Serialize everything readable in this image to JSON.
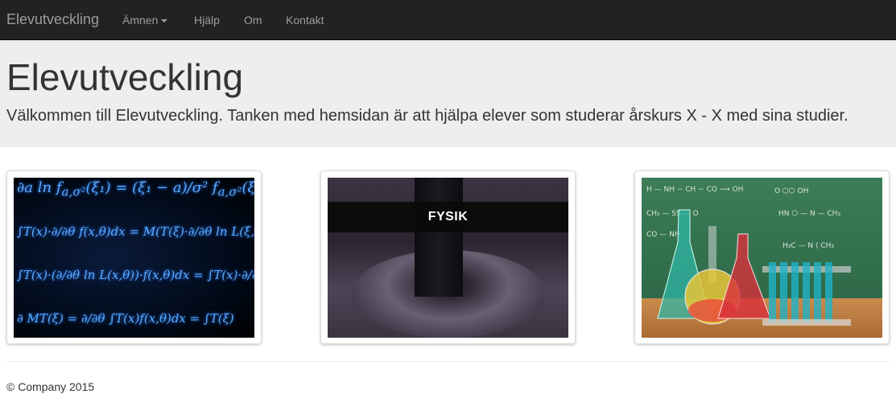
{
  "navbar": {
    "brand": "Elevutveckling",
    "items": [
      {
        "label": "Ämnen",
        "has_dropdown": true
      },
      {
        "label": "Hjälp"
      },
      {
        "label": "Om"
      },
      {
        "label": "Kontakt"
      }
    ]
  },
  "jumbotron": {
    "title": "Elevutveckling",
    "text": "Välkommen till Elevutveckling. Tanken med hemsidan är att hjälpa elever som studerar årskurs X - X med sina studier."
  },
  "thumbnails": [
    {
      "subject": "math",
      "icon": "math-formulas-image"
    },
    {
      "subject": "physics",
      "icon": "physics-magnet-image",
      "banner": "FYSIK"
    },
    {
      "subject": "chemistry",
      "icon": "chemistry-flasks-image"
    }
  ],
  "footer": {
    "text": "© Company 2015"
  },
  "colors": {
    "navbar_bg": "#222222",
    "nav_text": "#9d9d9d",
    "jumbotron_bg": "#eeeeee",
    "text": "#333333"
  }
}
